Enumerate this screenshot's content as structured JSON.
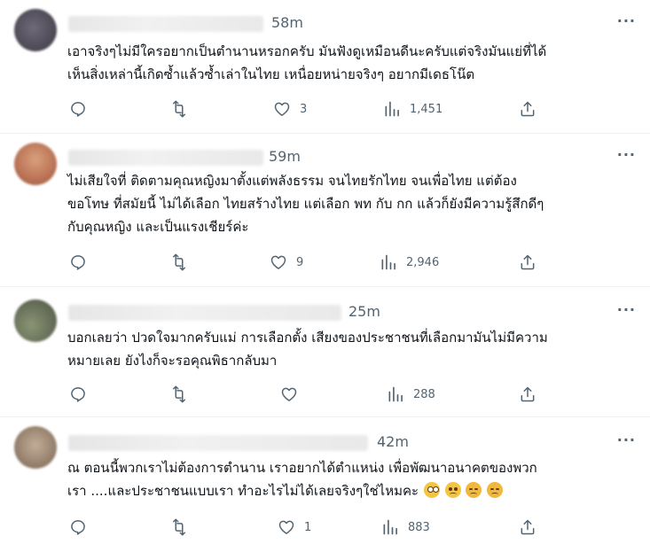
{
  "tweets": [
    {
      "time": "58m",
      "more_icon": "more-dots-icon",
      "lines": [
        "เอาจริงๆไม่มีใครอยากเป็นตำนานหรอกครับ มันฟังดูเหมือนดีนะครับแต่จริงมันแย่ที่ได้",
        "เห็นสิ่งเหล่านี้เกิดซ้ำแล้วซ้ำเล่าในไทย เหนื่อยหน่ายจริงๆ อยากมีเดธโน๊ต"
      ],
      "likes": "3",
      "views": "1,451",
      "avatar_color": "#5e5a68"
    },
    {
      "time": "59m",
      "more_icon": "more-dots-icon",
      "lines": [
        "ไม่เสียใจที่ ติดตามคุณหญิงมาตั้งแต่พลังธรรม จนไทยรักไทย จนเพื่อไทย แต่ต้อง",
        "ขอโทษ ที่สมัยนี้ ไม่ได้เลือก ไทยสร้างไทย แต่เลือก พท กับ กก แล้วก็ยังมีความรู้สึกดีๆ",
        "กับคุณหญิง และเป็นแรงเชียร์ค่ะ"
      ],
      "likes": "9",
      "views": "2,946",
      "avatar_color": "#c98a66"
    },
    {
      "time": "25m",
      "more_icon": "more-dots-icon",
      "lines": [
        "บอกเลยว่า ปวดใจมากครับแม่ การเลือกตั้ง เสียงของประชาชนที่เลือกมามันไม่มีความ",
        "หมายเลย ยังไงก็จะรอคุณพิธากลับมา"
      ],
      "likes": "",
      "views": "288",
      "avatar_color": "#707a62"
    },
    {
      "time": "42m",
      "more_icon": "more-dots-icon",
      "lines": [
        "ณ ตอนนี้พวกเราไม่ต้องการตำนาน  เราอยากได้ตำแหน่ง  เพื่อพัฒนาอนาคตของพวก",
        "เรา ....และประชาชนแบบเรา  ทำอะไรไม่ได้เลยจริงๆใช่ไหมคะ"
      ],
      "emojis": [
        "pleading-face-emoji",
        "sad-face-emoji",
        "steam-face-emoji",
        "steam-face-emoji"
      ],
      "likes": "1",
      "views": "883",
      "avatar_color": "#a89584"
    }
  ],
  "icons": {
    "reply": "reply-icon",
    "retweet": "retweet-icon",
    "like": "heart-icon",
    "views": "views-icon",
    "share": "share-icon"
  }
}
